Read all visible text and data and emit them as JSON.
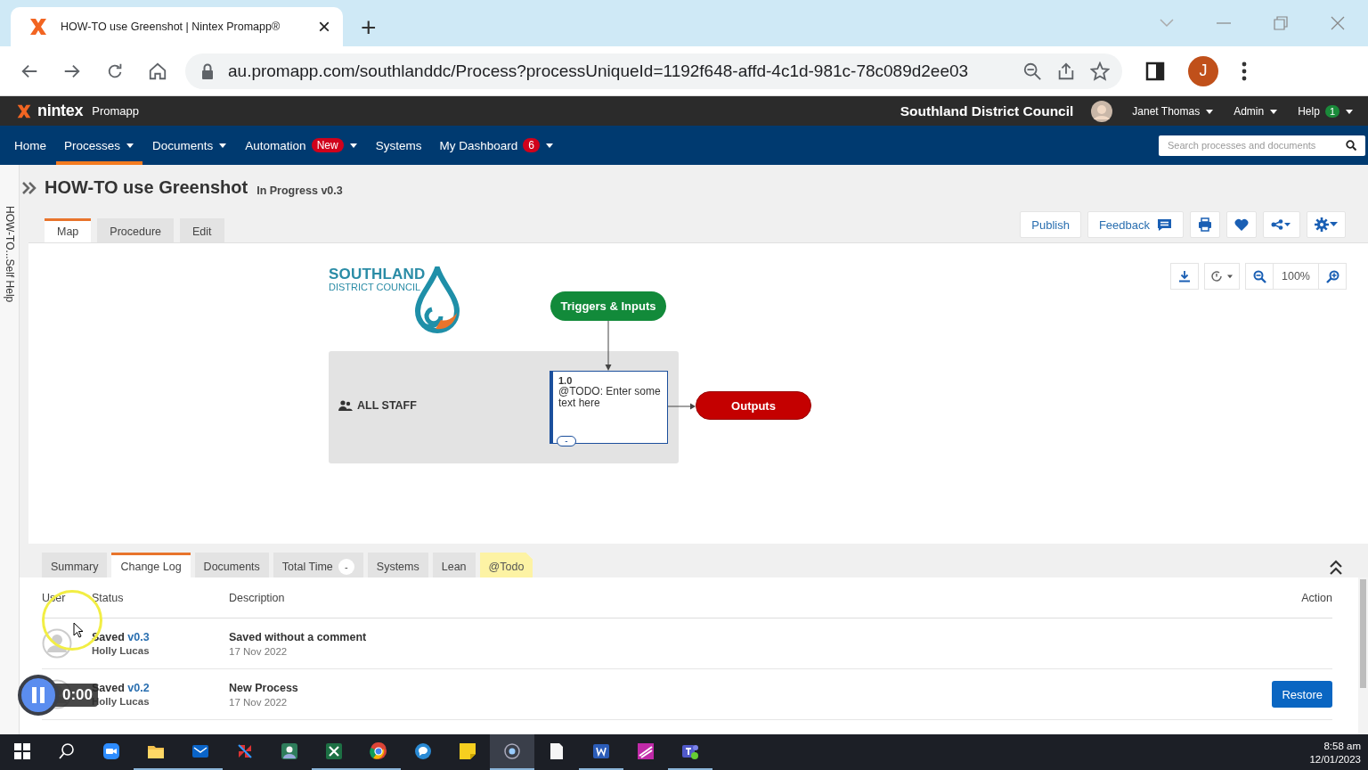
{
  "browser": {
    "tab_title": "HOW-TO use Greenshot | Nintex Promapp®",
    "tab_close": "×",
    "new_tab": "+",
    "url": "au.promapp.com/southlanddc/Process?processUniqueId=1192f648-affd-4c1d-981c-78c089d2ee03",
    "profile_initial": "J"
  },
  "app_header": {
    "brand": "nintex",
    "product": "Promapp",
    "org": "Southland District Council",
    "user": "Janet Thomas",
    "admin": "Admin",
    "help": "Help",
    "help_count": "1"
  },
  "nav": {
    "items": [
      {
        "label": "Home",
        "selected": false,
        "dropdown": false
      },
      {
        "label": "Processes",
        "selected": true,
        "dropdown": true
      },
      {
        "label": "Documents",
        "selected": false,
        "dropdown": true
      },
      {
        "label": "Automation",
        "selected": false,
        "dropdown": true,
        "badge": "New"
      },
      {
        "label": "Systems",
        "selected": false,
        "dropdown": false
      },
      {
        "label": "My Dashboard",
        "selected": false,
        "dropdown": true,
        "badge": "6"
      }
    ],
    "search_placeholder": "Search processes and documents"
  },
  "side_panel": {
    "label": "HOW-TO...Self Help"
  },
  "process": {
    "title": "HOW-TO use Greenshot",
    "status": "In Progress v0.3"
  },
  "view_tabs": [
    {
      "label": "Map",
      "selected": true
    },
    {
      "label": "Procedure",
      "selected": false
    },
    {
      "label": "Edit",
      "selected": false
    }
  ],
  "actions": [
    {
      "label": "Publish"
    },
    {
      "label": "Feedback"
    }
  ],
  "map_toolbar": {
    "zoom": "100%"
  },
  "map": {
    "logo": {
      "line1": "SOUTHLAND",
      "line2": "DISTRICT COUNCIL"
    },
    "trigger": "Triggers & Inputs",
    "lane": "ALL STAFF",
    "activity": {
      "number": "1.0",
      "text": "@TODO: Enter some text here",
      "toggle": "-"
    },
    "output": "Outputs"
  },
  "detail_tabs": [
    {
      "label": "Summary",
      "selected": false,
      "kind": "plain"
    },
    {
      "label": "Change Log",
      "selected": true,
      "kind": "plain"
    },
    {
      "label": "Documents",
      "selected": false,
      "kind": "plain"
    },
    {
      "label": "Total Time",
      "selected": false,
      "kind": "plain",
      "badge": "-"
    },
    {
      "label": "Systems",
      "selected": false,
      "kind": "plain"
    },
    {
      "label": "Lean",
      "selected": false,
      "kind": "plain"
    },
    {
      "label": "@Todo",
      "selected": false,
      "kind": "note"
    }
  ],
  "change_log": {
    "columns": [
      "User",
      "Status",
      "Description",
      "Action"
    ],
    "rows": [
      {
        "status": "Saved",
        "version": "v0.3",
        "user": "Holly Lucas",
        "description": "Saved without a comment",
        "date": "17 Nov 2022"
      },
      {
        "status": "Saved",
        "version": "v0.2",
        "user": "Holly Lucas",
        "description": "New Process",
        "date": "17 Nov 2022",
        "action": "Restore"
      }
    ]
  },
  "recorder": {
    "time": "0:00"
  },
  "taskbar": {
    "time": "8:58 am",
    "date": "12/01/2023"
  }
}
